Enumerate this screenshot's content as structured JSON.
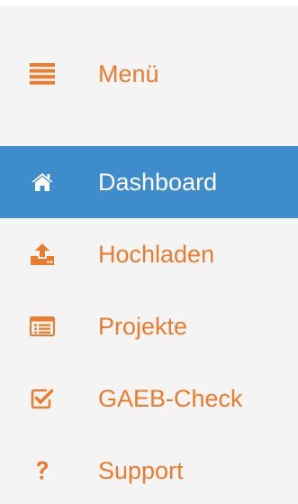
{
  "colors": {
    "accent": "#ec7b2c",
    "active_bg": "#3f8ccc",
    "active_text": "#ffffff",
    "sidebar_bg": "#f4f4f4"
  },
  "menu": {
    "label": "Menü",
    "icon": "hamburger-icon"
  },
  "items": [
    {
      "label": "Dashboard",
      "icon": "home-icon",
      "active": true
    },
    {
      "label": "Hochladen",
      "icon": "upload-icon",
      "active": false
    },
    {
      "label": "Projekte",
      "icon": "list-icon",
      "active": false
    },
    {
      "label": "GAEB-Check",
      "icon": "checkbox-icon",
      "active": false
    },
    {
      "label": "Support",
      "icon": "question-icon",
      "active": false
    }
  ]
}
